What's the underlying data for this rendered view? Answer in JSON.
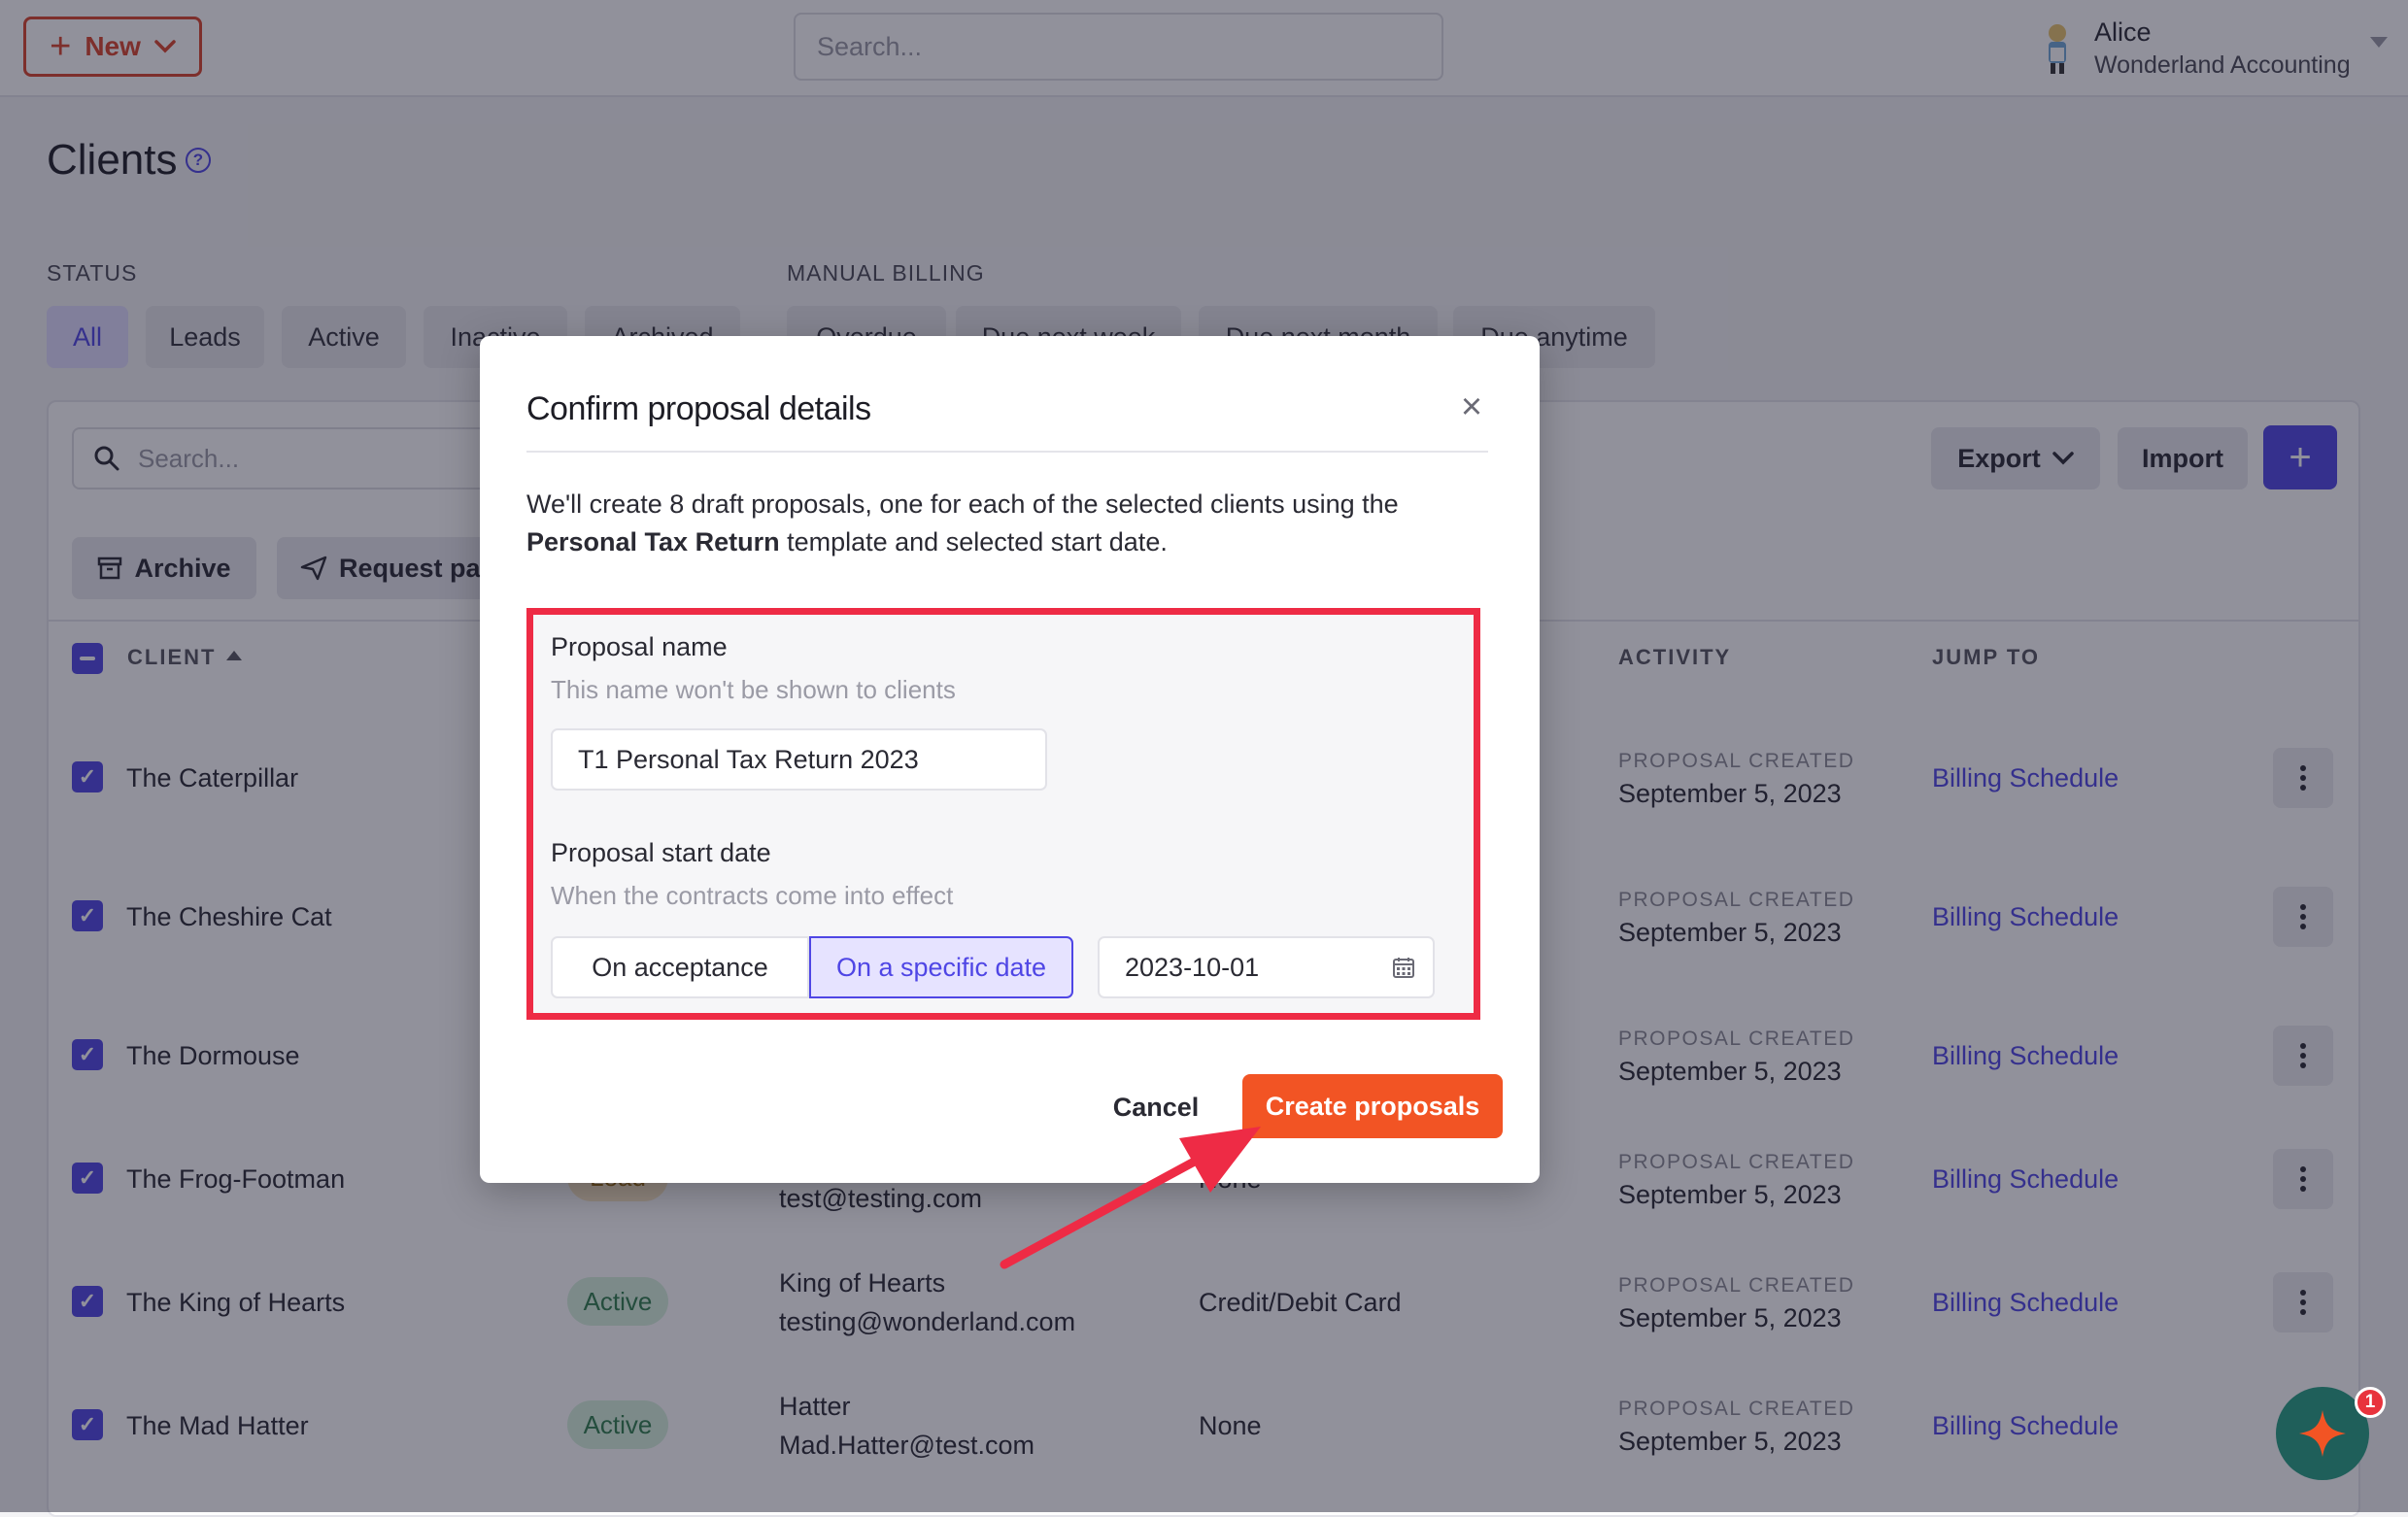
{
  "topbar": {
    "new_label": "New",
    "search_placeholder": "Search...",
    "user_name": "Alice",
    "user_org": "Wonderland Accounting"
  },
  "page": {
    "title": "Clients"
  },
  "filters": {
    "status_label": "STATUS",
    "status_chips": [
      "All",
      "Leads",
      "Active",
      "Inactive",
      "Archived"
    ],
    "billing_label": "MANUAL BILLING",
    "billing_chips": [
      "Overdue",
      "Due next week",
      "Due next month",
      "Due anytime"
    ]
  },
  "table": {
    "search_placeholder": "Search...",
    "export_label": "Export",
    "import_label": "Import",
    "archive_label": "Archive",
    "request_label": "Request payment",
    "headers": {
      "client": "CLIENT",
      "activity": "ACTIVITY",
      "jump_to": "JUMP TO"
    },
    "rows": [
      {
        "client": "The Caterpillar",
        "status": "",
        "contact_name": "",
        "contact_email": "",
        "method": "",
        "activity_label": "PROPOSAL CREATED",
        "activity_date": "September 5, 2023",
        "jump": "Billing Schedule"
      },
      {
        "client": "The Cheshire Cat",
        "status": "",
        "contact_name": "",
        "contact_email": "",
        "method": "",
        "activity_label": "PROPOSAL CREATED",
        "activity_date": "September 5, 2023",
        "jump": "Billing Schedule"
      },
      {
        "client": "The Dormouse",
        "status": "",
        "contact_name": "",
        "contact_email": "",
        "method": "",
        "activity_label": "PROPOSAL CREATED",
        "activity_date": "September 5, 2023",
        "jump": "Billing Schedule"
      },
      {
        "client": "The Frog-Footman",
        "status": "Lead",
        "contact_name": "",
        "contact_email": "test@testing.com",
        "method": "None",
        "activity_label": "PROPOSAL CREATED",
        "activity_date": "September 5, 2023",
        "jump": "Billing Schedule"
      },
      {
        "client": "The King of Hearts",
        "status": "Active",
        "contact_name": "King of Hearts",
        "contact_email": "testing@wonderland.com",
        "method": "Credit/Debit Card",
        "activity_label": "PROPOSAL CREATED",
        "activity_date": "September 5, 2023",
        "jump": "Billing Schedule"
      },
      {
        "client": "The Mad Hatter",
        "status": "Active",
        "contact_name": "Hatter",
        "contact_email": "Mad.Hatter@test.com",
        "method": "None",
        "activity_label": "PROPOSAL CREATED",
        "activity_date": "September 5, 2023",
        "jump": "Billing Schedule"
      }
    ]
  },
  "modal": {
    "title": "Confirm proposal details",
    "desc_part1": "We'll create 8 draft proposals, one for each of the selected clients using the",
    "desc_bold": "Personal Tax Return",
    "desc_part2": "template and selected start date.",
    "name_label": "Proposal name",
    "name_help": "This name won't be shown to clients",
    "name_value": "T1 Personal Tax Return 2023",
    "start_label": "Proposal start date",
    "start_help": "When the contracts come into effect",
    "opt_acceptance": "On acceptance",
    "opt_specific": "On a specific date",
    "date_value": "2023-10-01",
    "cancel_label": "Cancel",
    "create_label": "Create proposals"
  },
  "fab": {
    "badge": "1"
  },
  "colors": {
    "accent": "#4f46e5",
    "primary_action": "#f25424",
    "highlight": "#ee2b45",
    "brand_red": "#d9442b"
  }
}
